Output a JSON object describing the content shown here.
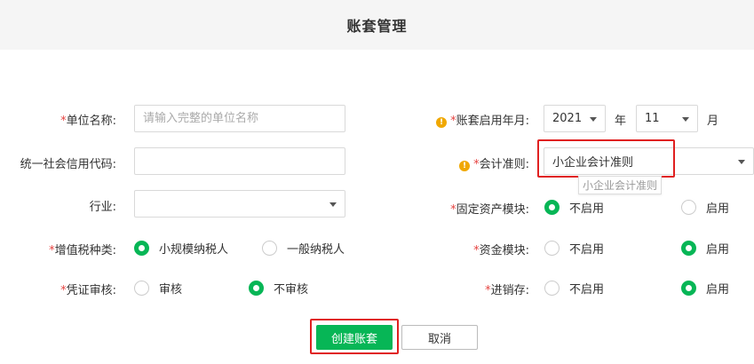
{
  "header": {
    "title": "账套管理"
  },
  "form": {
    "unit_name": {
      "required_mark": "*",
      "label": "单位名称:",
      "placeholder": "请输入完整的单位名称",
      "value": ""
    },
    "credit_code": {
      "label": "统一社会信用代码:",
      "value": ""
    },
    "industry": {
      "label": "行业:",
      "value": ""
    },
    "vat_type": {
      "required_mark": "*",
      "label": "增值税种类:",
      "options": [
        "小规模纳税人",
        "一般纳税人"
      ],
      "selected": "小规模纳税人"
    },
    "voucher_audit": {
      "required_mark": "*",
      "label": "凭证审核:",
      "options": [
        "审核",
        "不审核"
      ],
      "selected": "不审核"
    },
    "start_period": {
      "warn_icon": "!",
      "required_mark": "*",
      "label": "账套启用年月:",
      "year": "2021",
      "year_unit": "年",
      "month": "11",
      "month_unit": "月"
    },
    "accounting_standard": {
      "warn_icon": "!",
      "required_mark": "*",
      "label": "会计准则:",
      "value": "小企业会计准则",
      "tooltip": "小企业会计准则"
    },
    "fixed_assets": {
      "required_mark": "*",
      "label": "固定资产模块:",
      "options": [
        "不启用",
        "启用"
      ],
      "selected": "不启用"
    },
    "funds": {
      "required_mark": "*",
      "label": "资金模块:",
      "options": [
        "不启用",
        "启用"
      ],
      "selected": "启用"
    },
    "inventory": {
      "required_mark": "*",
      "label": "进销存:",
      "options": [
        "不启用",
        "启用"
      ],
      "selected": "启用"
    }
  },
  "actions": {
    "create_label": "创建账套",
    "cancel_label": "取消"
  },
  "colors": {
    "accent": "#07b656",
    "highlight": "#e02020",
    "required": "#e64340",
    "warning": "#f0a800"
  }
}
